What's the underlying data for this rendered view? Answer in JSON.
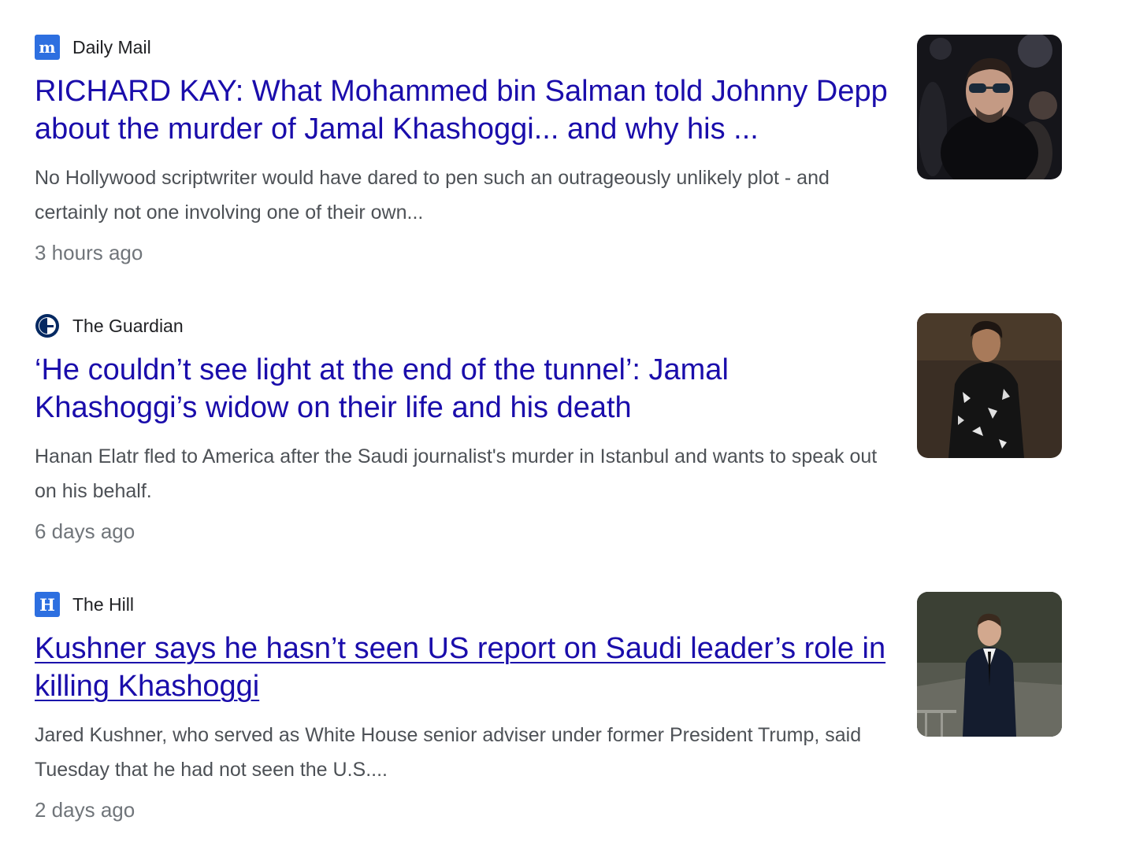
{
  "results": [
    {
      "source": "Daily Mail",
      "source_icon": "daily-mail-logo-icon",
      "headline": "RICHARD KAY: What Mohammed bin Salman told Johnny Depp about the murder of Jamal Khashoggi... and why his ...",
      "snippet": "No Hollywood scriptwriter would have dared to pen such an outrageously unlikely plot - and certainly not one involving one of their own...",
      "time": "3 hours ago"
    },
    {
      "source": "The Guardian",
      "source_icon": "guardian-logo-icon",
      "headline": "‘He couldn’t see light at the end of the tunnel’: Jamal Khashoggi’s widow on their life and his death",
      "snippet": "Hanan Elatr fled to America after the Saudi journalist's murder in Istanbul and wants to speak out on his behalf.",
      "time": "6 days ago"
    },
    {
      "source": "The Hill",
      "source_icon": "the-hill-logo-icon",
      "headline": "Kushner says he hasn’t seen US report on Saudi leader’s role in killing Khashoggi",
      "snippet": "Jared Kushner, who served as White House senior adviser under former President Trump, said Tuesday that he had not seen the U.S....",
      "time": "2 days ago"
    }
  ],
  "colors": {
    "headline_link": "#1a0dab",
    "snippet_text": "#4d5156",
    "timestamp_text": "#70757a",
    "source_text": "#202124"
  }
}
